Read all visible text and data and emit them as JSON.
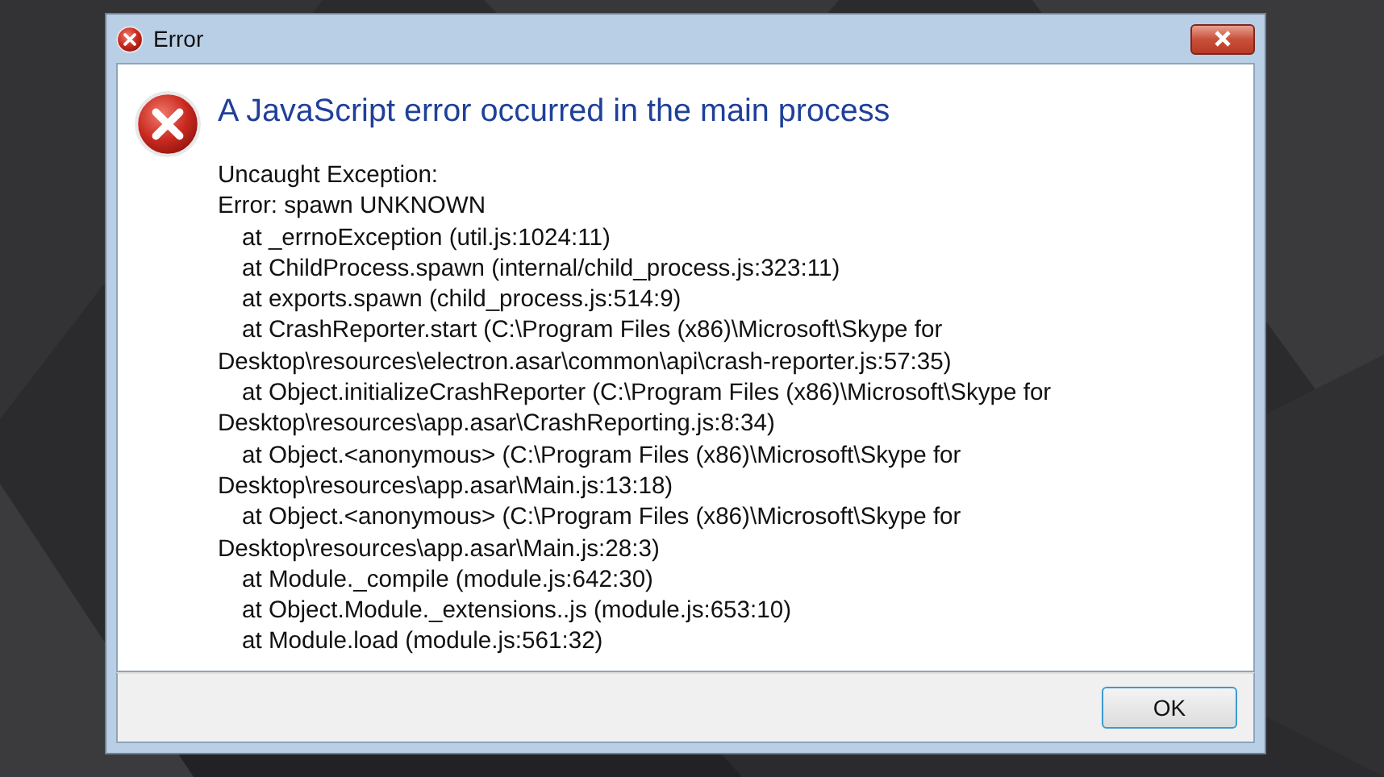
{
  "window": {
    "title": "Error"
  },
  "heading": "A JavaScript error occurred in the main process",
  "lines": [
    {
      "text": "Uncaught Exception:",
      "indented": false
    },
    {
      "text": "Error: spawn UNKNOWN",
      "indented": false
    },
    {
      "text": "at _errnoException (util.js:1024:11)",
      "indented": true
    },
    {
      "text": "at ChildProcess.spawn (internal/child_process.js:323:11)",
      "indented": true
    },
    {
      "text": "at exports.spawn (child_process.js:514:9)",
      "indented": true
    },
    {
      "text": "at CrashReporter.start (C:\\Program Files (x86)\\Microsoft\\Skype for",
      "indented": true
    },
    {
      "text": "Desktop\\resources\\electron.asar\\common\\api\\crash-reporter.js:57:35)",
      "indented": false
    },
    {
      "text": "at Object.initializeCrashReporter (C:\\Program Files (x86)\\Microsoft\\Skype for",
      "indented": true
    },
    {
      "text": "Desktop\\resources\\app.asar\\CrashReporting.js:8:34)",
      "indented": false
    },
    {
      "text": "at Object.<anonymous> (C:\\Program Files (x86)\\Microsoft\\Skype for",
      "indented": true
    },
    {
      "text": "Desktop\\resources\\app.asar\\Main.js:13:18)",
      "indented": false
    },
    {
      "text": "at Object.<anonymous> (C:\\Program Files (x86)\\Microsoft\\Skype for",
      "indented": true
    },
    {
      "text": "Desktop\\resources\\app.asar\\Main.js:28:3)",
      "indented": false
    },
    {
      "text": "at Module._compile (module.js:642:30)",
      "indented": true
    },
    {
      "text": "at Object.Module._extensions..js (module.js:653:10)",
      "indented": true
    },
    {
      "text": "at Module.load (module.js:561:32)",
      "indented": true
    }
  ],
  "buttons": [
    "OK"
  ]
}
